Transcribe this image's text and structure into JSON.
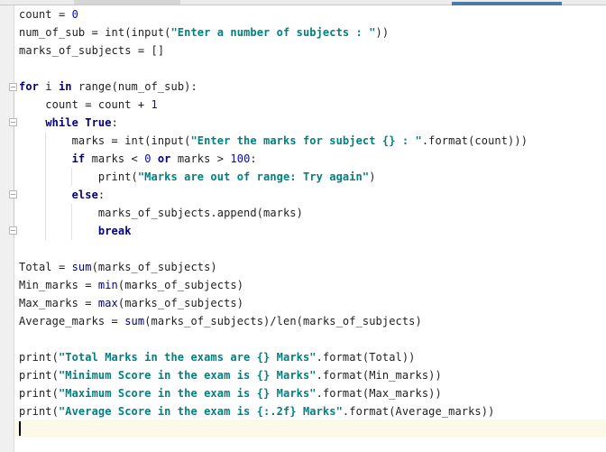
{
  "editor": {
    "language": "python",
    "lines": [
      [
        {
          "t": "count = ",
          "c": ""
        },
        {
          "t": "0",
          "c": "num"
        }
      ],
      [
        {
          "t": "num_of_sub = int(input(",
          "c": ""
        },
        {
          "t": "\"Enter a number of subjects : \"",
          "c": "str"
        },
        {
          "t": "))",
          "c": ""
        }
      ],
      [
        {
          "t": "marks_of_subjects = []",
          "c": ""
        }
      ],
      [],
      [
        {
          "t": "for",
          "c": "kw"
        },
        {
          "t": " i ",
          "c": ""
        },
        {
          "t": "in",
          "c": "kw"
        },
        {
          "t": " range(num_of_sub):",
          "c": ""
        }
      ],
      [
        {
          "t": "    count = count + ",
          "c": ""
        },
        {
          "t": "1",
          "c": "num"
        }
      ],
      [
        {
          "t": "    ",
          "c": ""
        },
        {
          "t": "while",
          "c": "kw"
        },
        {
          "t": " ",
          "c": ""
        },
        {
          "t": "True",
          "c": "kw"
        },
        {
          "t": ":",
          "c": ""
        }
      ],
      [
        {
          "t": "        marks = int(input(",
          "c": ""
        },
        {
          "t": "\"Enter the marks for subject {} : \"",
          "c": "str"
        },
        {
          "t": ".format(count)))",
          "c": ""
        }
      ],
      [
        {
          "t": "        ",
          "c": ""
        },
        {
          "t": "if",
          "c": "kw"
        },
        {
          "t": " marks < ",
          "c": ""
        },
        {
          "t": "0",
          "c": "num"
        },
        {
          "t": " ",
          "c": ""
        },
        {
          "t": "or",
          "c": "kw"
        },
        {
          "t": " marks > ",
          "c": ""
        },
        {
          "t": "100",
          "c": "num"
        },
        {
          "t": ":",
          "c": ""
        }
      ],
      [
        {
          "t": "            print(",
          "c": ""
        },
        {
          "t": "\"Marks are out of range: Try again\"",
          "c": "str"
        },
        {
          "t": ")",
          "c": ""
        }
      ],
      [
        {
          "t": "        ",
          "c": ""
        },
        {
          "t": "else",
          "c": "kw"
        },
        {
          "t": ":",
          "c": ""
        }
      ],
      [
        {
          "t": "            marks_of_subjects.append(marks)",
          "c": ""
        }
      ],
      [
        {
          "t": "            ",
          "c": ""
        },
        {
          "t": "break",
          "c": "kw"
        }
      ],
      [],
      [
        {
          "t": "Total = ",
          "c": ""
        },
        {
          "t": "sum",
          "c": "bi"
        },
        {
          "t": "(marks_of_subjects)",
          "c": ""
        }
      ],
      [
        {
          "t": "Min_marks = ",
          "c": ""
        },
        {
          "t": "min",
          "c": "bi"
        },
        {
          "t": "(marks_of_subjects)",
          "c": ""
        }
      ],
      [
        {
          "t": "Max_marks = ",
          "c": ""
        },
        {
          "t": "max",
          "c": "bi"
        },
        {
          "t": "(marks_of_subjects)",
          "c": ""
        }
      ],
      [
        {
          "t": "Average_marks = ",
          "c": ""
        },
        {
          "t": "sum",
          "c": "bi"
        },
        {
          "t": "(marks_of_subjects)/len(marks_of_subjects)",
          "c": ""
        }
      ],
      [],
      [
        {
          "t": "print(",
          "c": ""
        },
        {
          "t": "\"Total Marks in the exams are {} Marks\"",
          "c": "str"
        },
        {
          "t": ".format(Total))",
          "c": ""
        }
      ],
      [
        {
          "t": "print(",
          "c": ""
        },
        {
          "t": "\"Minimum Score in the exam is {} Marks\"",
          "c": "str"
        },
        {
          "t": ".format(Min_marks))",
          "c": ""
        }
      ],
      [
        {
          "t": "print(",
          "c": ""
        },
        {
          "t": "\"Maximum Score in the exam is {} Marks\"",
          "c": "str"
        },
        {
          "t": ".format(Max_marks))",
          "c": ""
        }
      ],
      [
        {
          "t": "print(",
          "c": ""
        },
        {
          "t": "\"Average Score in the exam is {:.2f} Marks\"",
          "c": "str"
        },
        {
          "t": ".format(Average_marks))",
          "c": ""
        }
      ],
      []
    ],
    "current_line": 24
  },
  "colors": {
    "keyword": "#000080",
    "string": "#008080",
    "number": "#0000ff",
    "scroll_indicator": "#4a7aa6",
    "current_line_bg": "#fdf9e8"
  }
}
